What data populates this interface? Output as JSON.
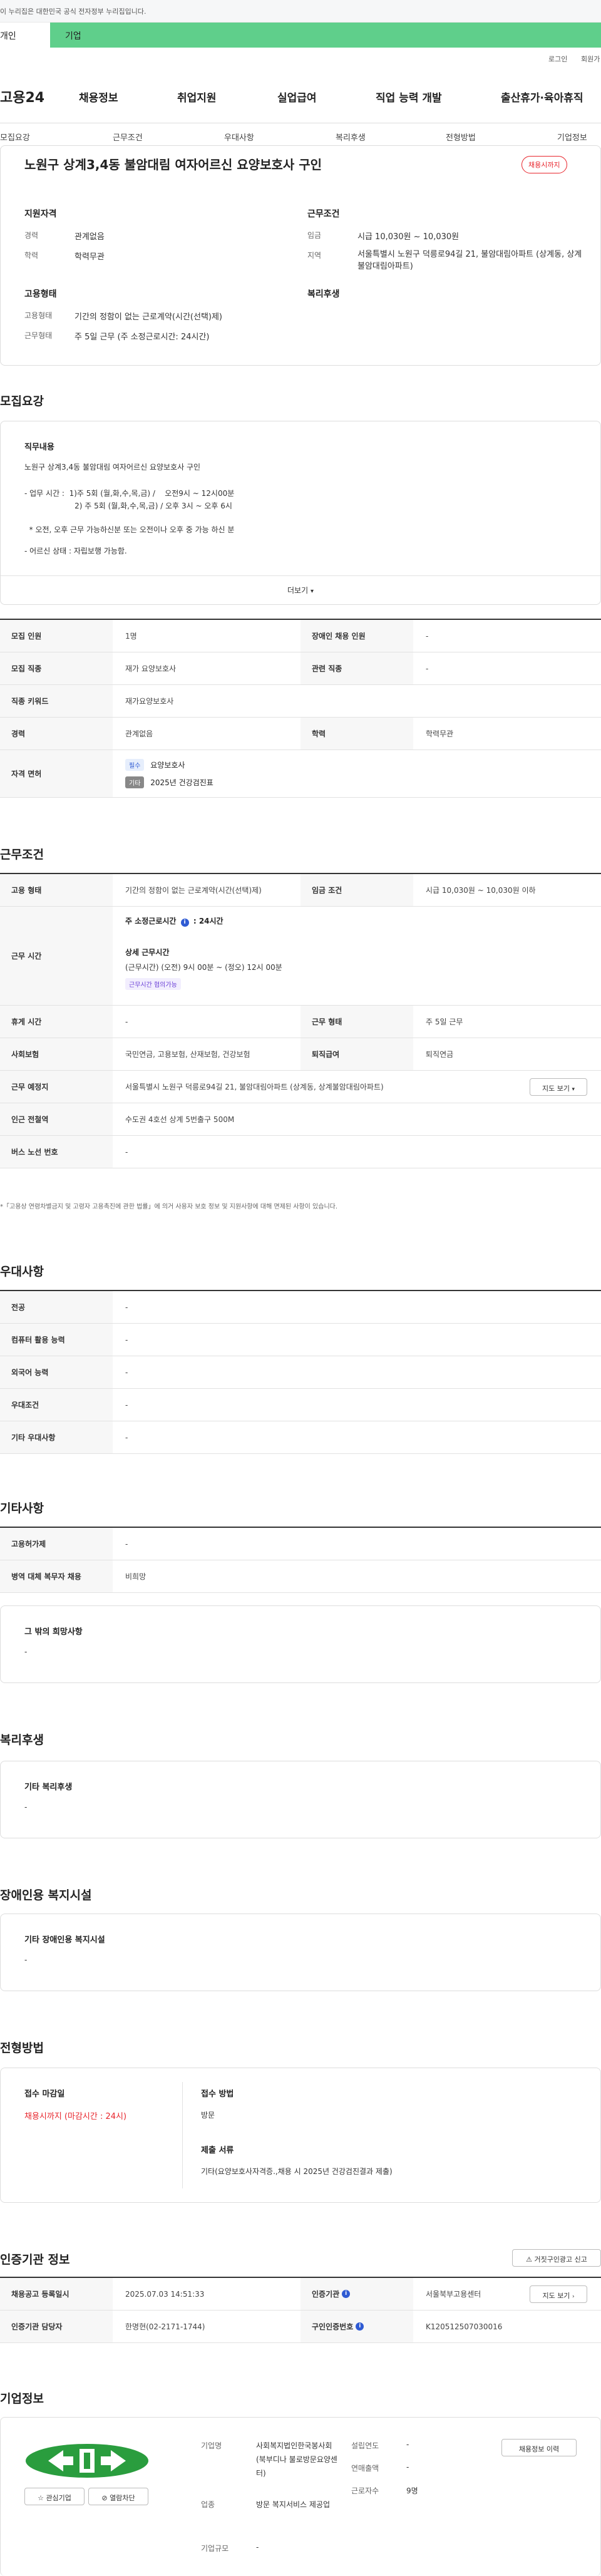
{
  "gov_notice": "이 누리집은 대한민국 공식 전자정부 누리집입니다.",
  "user_tabs": {
    "personal": "개인",
    "company": "기업"
  },
  "util_links": {
    "login": "로그인",
    "signup": "회원가"
  },
  "logo": "고용24",
  "gnb": [
    "채용정보",
    "취업지원",
    "실업급여",
    "직업 능력 개발",
    "출산휴가·육아휴직"
  ],
  "sub_nav": [
    "모집요강",
    "근무조건",
    "우대사항",
    "복리후생",
    "전형방법",
    "기업정보"
  ],
  "job": {
    "title": "노원구 상계3,4동 불암대림 여자어르신 요양보호사 구인",
    "status_badge": "채용시까지",
    "qualification_title": "지원자격",
    "career_label": "경력",
    "career_value": "관계없음",
    "education_label": "학력",
    "education_value": "학력무관",
    "employment_title": "고용형태",
    "emp_type_label": "고용형태",
    "emp_type_value": "기간의 정함이 없는 근로계약(시간(선택)제)",
    "work_type_label": "근무형태",
    "work_type_value": "주 5일 근무 (주 소정근로시간: 24시간)",
    "conditions_title": "근무조건",
    "wage_label": "임금",
    "wage_value": "시급 10,030원 ~ 10,030원",
    "region_label": "지역",
    "region_value": "서울특별시 노원구 덕릉로94길 21, 불암대림아파트 (상계동, 상계불암대림아파트)",
    "welfare_title": "복리후생"
  },
  "recruit": {
    "section_title": "모집요강",
    "duty_title": "직무내용",
    "duty_lines": [
      "노원구 상계3,4동 불암대림 여자어르신 요양보호사 구인",
      "- 업무 시간 :  1)주 5회 (월,화,수,목,금) /    오전9시 ~ 12시00분",
      "                     2) 주 5회 (월,화,수,목,금) / 오후 3시 ~ 오후 6시",
      "  * 오전, 오후 근무 가능하신분 또는 오전이나 오후 중 가능 하신 분",
      "- 어르신 상태 : 자립보행 가능함."
    ],
    "more_button": "더보기",
    "rows": [
      {
        "l1": "모집 인원",
        "v1": "1명",
        "l2": "장애인 채용 인원",
        "v2": "-"
      },
      {
        "l1": "모집 직종",
        "v1": "재가 요양보호사",
        "l2": "관련 직종",
        "v2": "-"
      },
      {
        "l1": "직종 키워드",
        "v1": "재가요양보호사"
      },
      {
        "l1": "경력",
        "v1": "관계없음",
        "l2": "학력",
        "v2": "학력무관"
      }
    ],
    "license_label": "자격 면허",
    "license_items": [
      {
        "tag": "필수",
        "name": "요양보호사"
      },
      {
        "tag": "기타",
        "name": "2025년 건강검진표"
      }
    ]
  },
  "conditions": {
    "section_title": "근무조건",
    "emp_label": "고용 형태",
    "emp_value": "기간의 정함이 없는 근로계약(시간(선택)제)",
    "wage_label": "임금 조건",
    "wage_value": "시급 10,030원 ~ 10,030원 이하",
    "hours_label": "근무 시간",
    "hours_weekly": "주 소정근로시간",
    "hours_weekly_value": ": 24시간",
    "hours_detail_title": "상세 근무시간",
    "hours_detail_value": "(근무시간) (오전) 9시 00분 ~ (정오) 12시 00분",
    "hours_tag": "근무시간 협의가능",
    "break_label": "휴게 시간",
    "break_value": "-",
    "shift_label": "근무 형태",
    "shift_value": "주 5일 근무",
    "insurance_label": "사회보험",
    "insurance_value": "국민연금, 고용보험, 산재보험, 건강보험",
    "retire_label": "퇴직급여",
    "retire_value": "퇴직연금",
    "place_label": "근무 예정지",
    "place_value": "서울특별시 노원구 덕릉로94길 21, 불암대림아파트 (상계동, 상계불암대림아파트)",
    "map_button": "지도 보기",
    "subway_label": "인근 전철역",
    "subway_value": "수도권 4호선 상계 5번출구 500M",
    "bus_label": "버스 노선 번호",
    "bus_value": "-",
    "footnote": "*「고용상 연령차별금지 및 고령자 고용촉진에 관한 법률」에 의거 사용자 보호 정보 및 지원사항에 대해 면제된 사항이 있습니다."
  },
  "preference": {
    "section_title": "우대사항",
    "rows": [
      {
        "label": "전공",
        "value": "-"
      },
      {
        "label": "컴퓨터 활용 능력",
        "value": "-"
      },
      {
        "label": "외국어 능력",
        "value": "-"
      },
      {
        "label": "우대조건",
        "value": "-"
      },
      {
        "label": "기타 우대사항",
        "value": "-"
      }
    ]
  },
  "etc": {
    "section_title": "기타사항",
    "rows": [
      {
        "label": "고용허가제",
        "value": "-"
      },
      {
        "label": "병역 대체 복무자 채용",
        "value": "비희망"
      }
    ],
    "other_title": "그 밖의 희망사항",
    "other_value": "-"
  },
  "welfare": {
    "section_title": "복리후생",
    "box_title": "기타 복리후생",
    "box_value": "-"
  },
  "disabled": {
    "section_title": "장애인용 복지시설",
    "box_title": "기타 장애인용 복지시설",
    "box_value": "-"
  },
  "screening": {
    "section_title": "전형방법",
    "deadline_title": "접수 마감일",
    "deadline_value": "채용시까지 (마감시간 : 24시)",
    "method_title": "접수 방법",
    "method_value": "방문",
    "docs_title": "제출 서류",
    "docs_value": "기타(요양보호사자격증.,채용 시 2025년 건강검진결과 제출)"
  },
  "agency": {
    "section_title": "인증기관 정보",
    "report_button": "거짓구인광고 신고",
    "reg_date_label": "채용공고 등록일시",
    "reg_date_value": "2025.07.03 14:51:33",
    "agency_label": "인증기관",
    "agency_value": "서울북부고용센터",
    "map_button": "지도 보기",
    "manager_label": "인증기관 담당자",
    "manager_value": "한명현(02-2171-1744)",
    "job_no_label": "구인인증번호",
    "job_no_value": "K120512507030016"
  },
  "company": {
    "section_title": "기업정보",
    "interest_button": "관심기업",
    "block_button": "열람차단",
    "name_label": "기업명",
    "name_value": "사회복지법인한국봉사회(북부디나 불로방문요양센터)",
    "industry_label": "업종",
    "industry_value": "방문 복지서비스 제공업",
    "size_label": "기업규모",
    "size_value": "-",
    "founded_label": "설립연도",
    "founded_value": "-",
    "revenue_label": "연매출액",
    "revenue_value": "-",
    "employees_label": "근로자수",
    "employees_value": "9명",
    "jobs_button": "채용정보 이력"
  }
}
